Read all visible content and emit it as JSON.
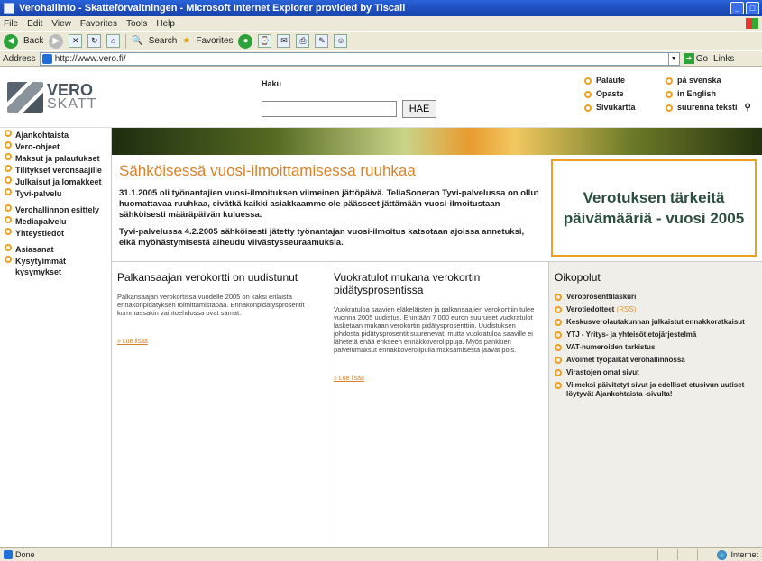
{
  "window": {
    "title": "Verohallinto - Skatteförvaltningen - Microsoft Internet Explorer provided by Tiscali",
    "minimize_icon": "minimize-icon",
    "close_icon": "close-icon"
  },
  "menubar": {
    "items": [
      "File",
      "Edit",
      "View",
      "Favorites",
      "Tools",
      "Help"
    ]
  },
  "toolbar": {
    "back_label": "Back",
    "search_label": "Search",
    "favorites_label": "Favorites"
  },
  "addressbar": {
    "label": "Address",
    "url": "http://www.vero.fi/",
    "go_label": "Go",
    "links_label": "Links"
  },
  "header": {
    "logo_line1": "VERO",
    "logo_line2": "SKATT",
    "search_label": "Haku",
    "search_value": "",
    "search_button": "HAE",
    "links_col1": [
      "Palaute",
      "Opaste",
      "Sivukartta"
    ],
    "links_col2": [
      "på svenska",
      "in English",
      "suurenna teksti"
    ]
  },
  "leftnav": {
    "items": [
      "Ajankohtaista",
      "Vero-ohjeet",
      "Maksut ja palautukset",
      "Tilitykset veronsaajille",
      "Julkaisut ja lomakkeet",
      "Tyvi-palvelu",
      "Verohallinnon esittely",
      "Mediapalvelu",
      "Yhteystiedot",
      "Asiasanat",
      "Kysytyimmät kysymykset"
    ]
  },
  "main": {
    "headline": "Sähköisessä vuosi-ilmoittamisessa ruuhkaa",
    "paragraph1": "31.1.2005 oli työnantajien vuosi-ilmoituksen viimeinen jättöpäivä. TeliaSoneran Tyvi-palvelussa on ollut huomattavaa ruuhkaa, eivätkä kaikki asiakkaamme ole päässeet jättämään vuosi-ilmoitustaan sähköisesti määräpäivän kuluessa.",
    "paragraph2": "Tyvi-palvelussa 4.2.2005 sähköisesti jätetty työnantajan vuosi-ilmoitus katsotaan ajoissa annetuksi, eikä myöhästymisestä aiheudu viivästysseuraamuksia.",
    "box_text": "Verotuksen tärkeitä päivämääriä - vuosi 2005"
  },
  "columns": {
    "col1": {
      "title": "Palkansaajan verokortti on uudistunut",
      "text": "Palkansaajan verokortissa vuodelle 2005 on kaksi erilaista ennakonpidätyksen toimittamistapaa. Ennakonpidätysprosentit kummassakin vaihtoehdossa ovat samat.",
      "read_more": "» Lue lisää"
    },
    "col2": {
      "title": "Vuokratulot mukana verokortin pidätysprosentissa",
      "text": "Vuokratuloa saavien eläkeläisten ja palkansaajien verokorttiin tulee vuonna 2005 uudistus. Enintään 7 000 euron suuruiset vuokratulot lasketaan mukaan verokortin pidätysprosenttiin. Uudistuksen johdosta pidätysprosentit suurenevat, mutta vuokratuloa saaville ei lähetetä enää erikseen ennakkoverolippuja. Myös pankkien palvelumaksut ennakkoverolipulla maksamisesta jäävät pois.",
      "read_more": "» Lue lisää"
    },
    "col3": {
      "title": "Oikopolut",
      "links": [
        "Veroprosenttilaskuri",
        "Verotiedotteet",
        "Keskusverolautakunnan julkaistut ennakkoratkaisut",
        "YTJ - Yritys- ja yhteisötietojärjestelmä",
        "VAT-numeroiden tarkistus",
        "Avoimet työpaikat verohallinnossa",
        "Virastojen omat sivut",
        "Viimeksi päivitetyt sivut ja edelliset etusivun uutiset löytyvät Ajankohtaista -sivulta!"
      ],
      "rss_label": "(RSS)"
    }
  },
  "statusbar": {
    "status": "Done",
    "zone": "Internet"
  },
  "colors": {
    "accent_orange": "#d9822b",
    "bullet_orange": "#f0a020",
    "box_text_green": "#2c4f3d",
    "titlebar_blue": "#1f4fbf"
  }
}
